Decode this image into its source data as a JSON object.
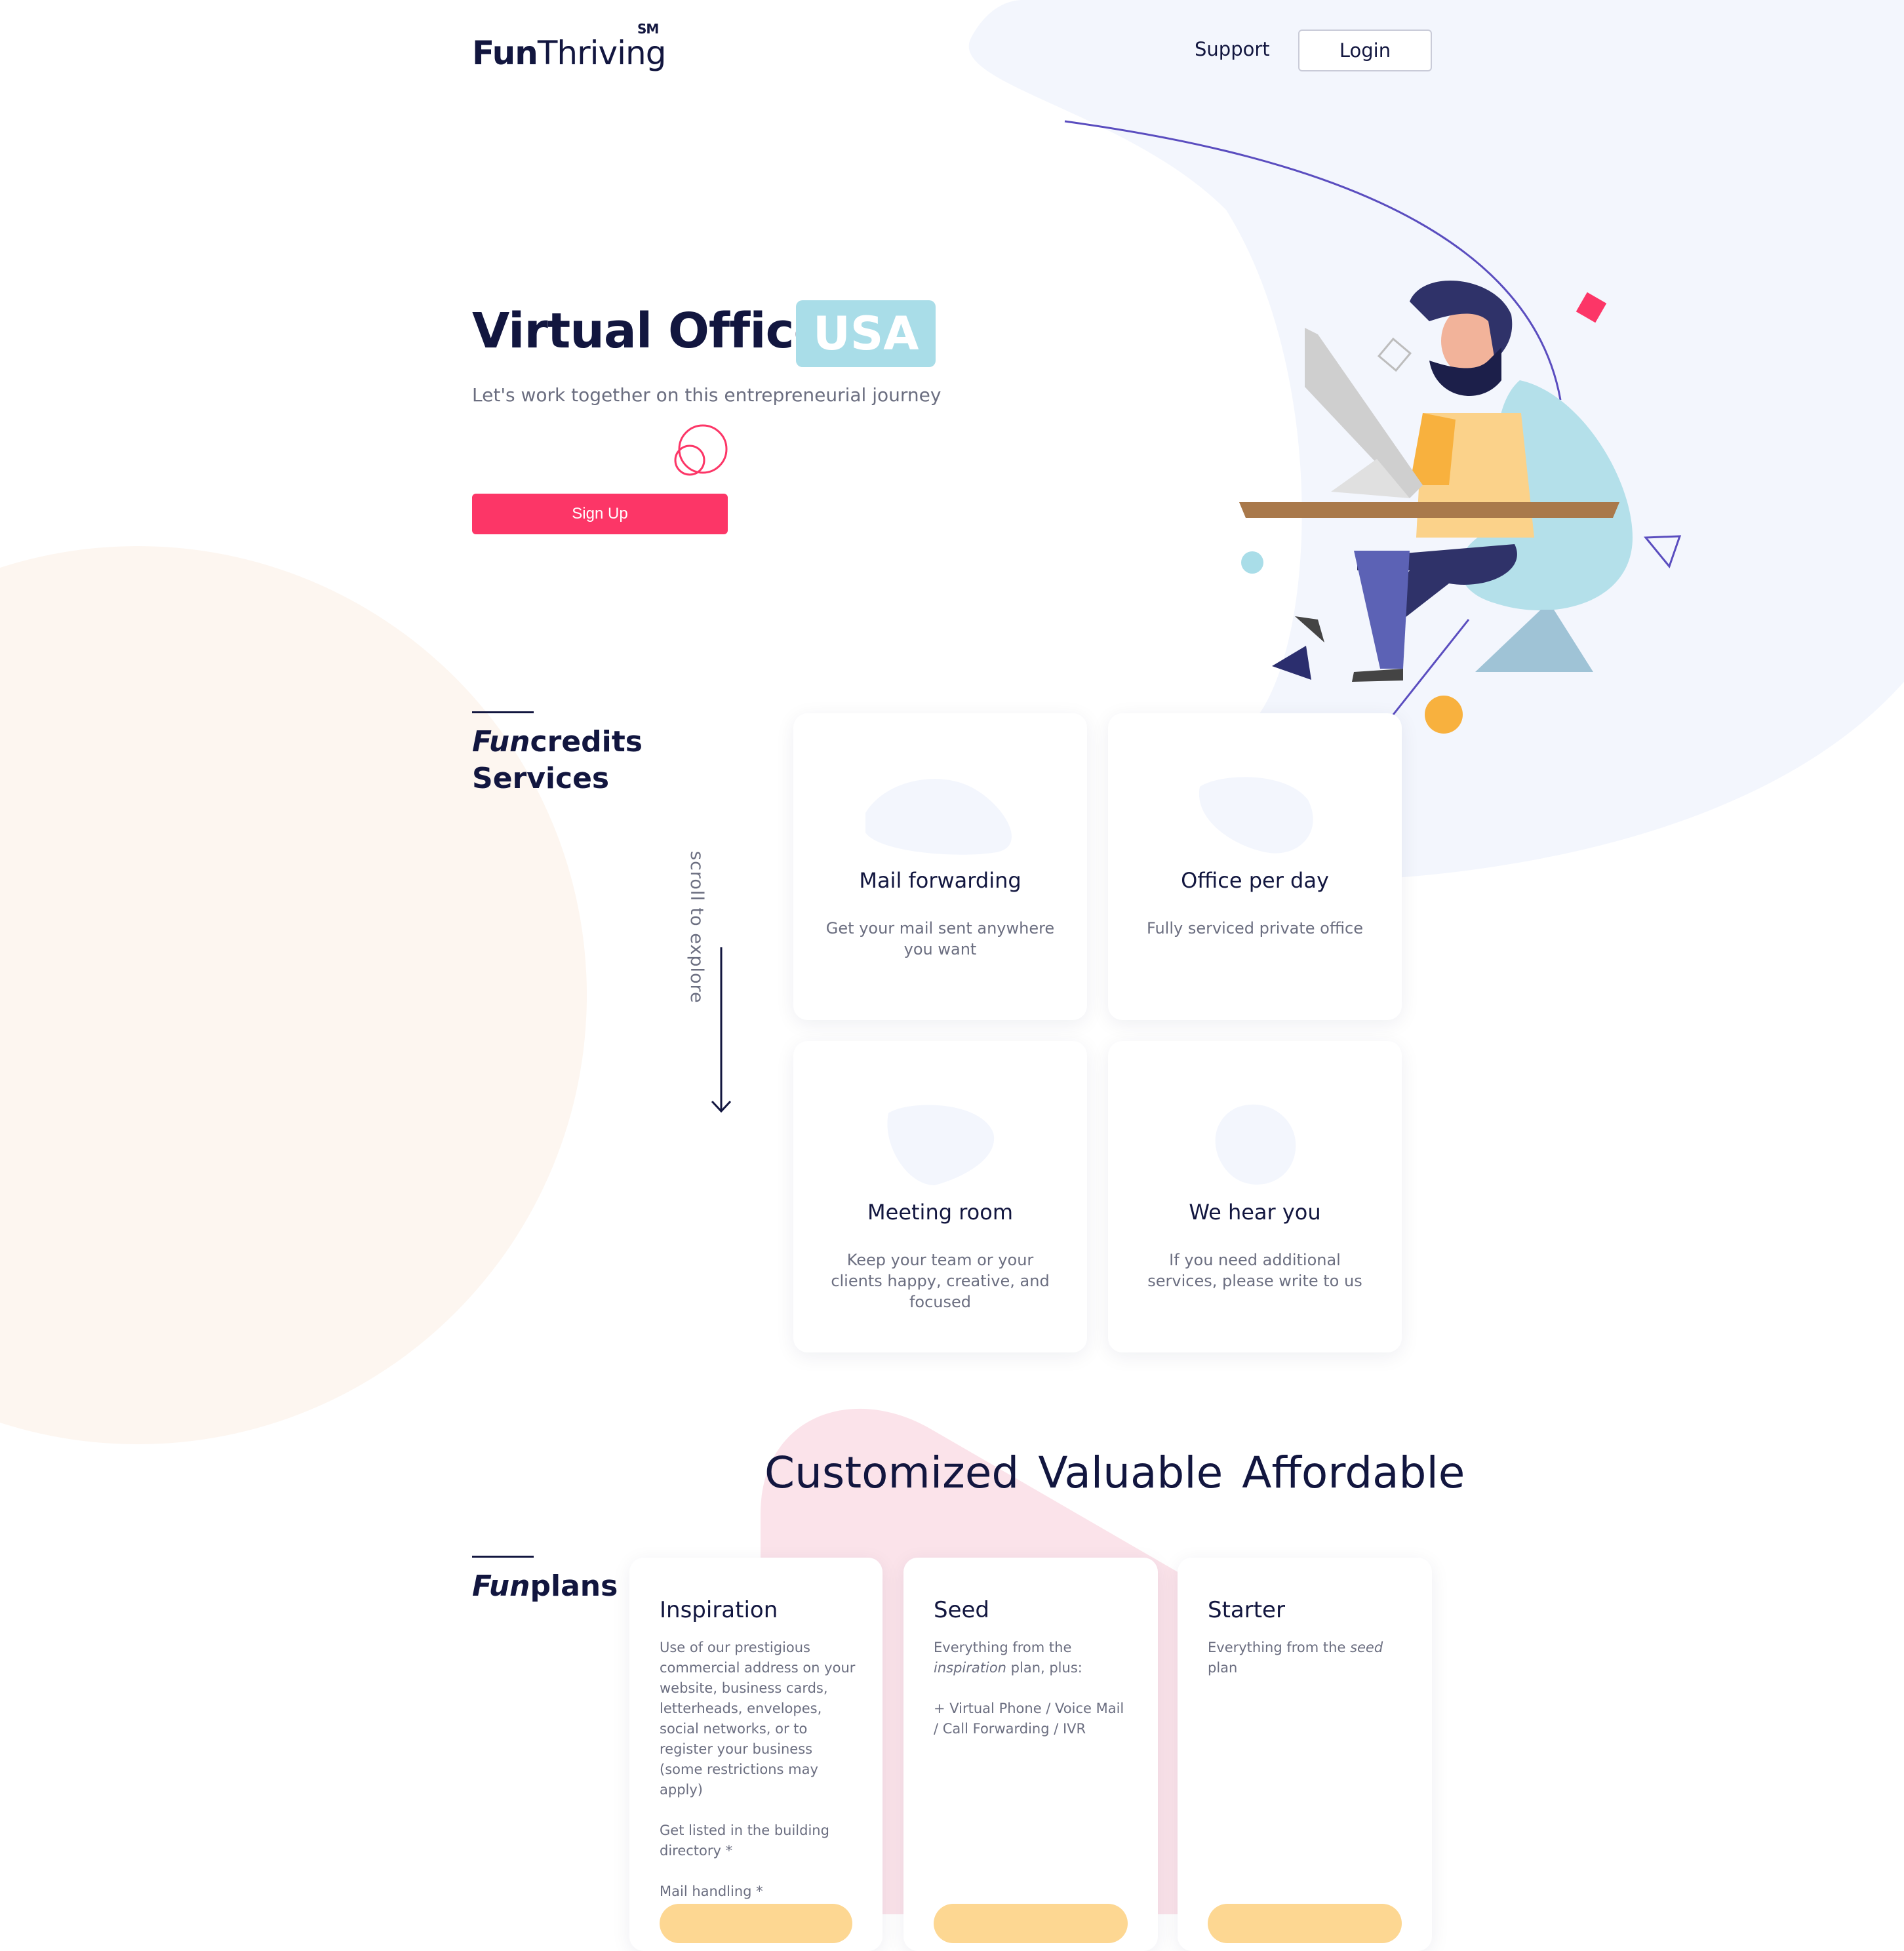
{
  "header": {
    "logo_fun": "Fun",
    "logo_thriving": "Thriving",
    "logo_mark": "SM",
    "nav_support": "Support",
    "nav_login": "Login"
  },
  "hero": {
    "title": "Virtual Office",
    "badge": "USA",
    "subtitle": "Let's work together on this entrepreneurial journey",
    "signup_label": "Sign Up"
  },
  "services": {
    "heading_italic": "Fun",
    "heading_rest": "credits",
    "heading_line2": "Services",
    "scroll_hint": "scroll to explore",
    "cards": [
      {
        "title": "Mail forwarding",
        "desc": "Get your mail sent anywhere you want"
      },
      {
        "title": "Office per day",
        "desc": "Fully serviced private office"
      },
      {
        "title": "Meeting room",
        "desc": "Keep your team or your clients happy, creative, and focused"
      },
      {
        "title": "We hear you",
        "desc": "If you need additional services, please write to us"
      }
    ]
  },
  "tagline": {
    "w1": "Customized",
    "w2": "Valuable",
    "w3": "Affordable"
  },
  "plans": {
    "heading_italic": "Fun",
    "heading_rest": "plans",
    "items": [
      {
        "title": "Inspiration",
        "p1": "Use of our prestigious commercial address on your website, business cards, letterheads, envelopes, social networks, or to register your business (some restrictions may apply)",
        "p2": "Get listed in the building directory *",
        "p3": "Mail handling *"
      },
      {
        "title": "Seed",
        "p1_a": "Everything from the ",
        "p1_b": "inspiration",
        "p1_c": " plan, plus:",
        "p2": "+ Virtual Phone / Voice Mail / Call Forwarding / IVR"
      },
      {
        "title": "Starter",
        "p1_a": "Everything from the ",
        "p1_b": "seed",
        "p1_c": " plan"
      }
    ]
  },
  "colors": {
    "navy": "#12163f",
    "accent_pink": "#fc3667",
    "badge_blue": "#a9dde8",
    "plan_button": "#fdd792",
    "bg_blue": "#f3f6fd",
    "bg_peach": "#fdf6f0",
    "bg_pink": "#fbe3ea"
  }
}
